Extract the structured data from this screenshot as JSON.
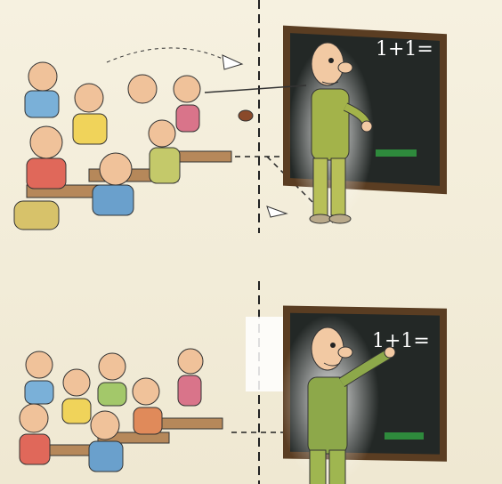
{
  "panels": [
    {
      "id": "top",
      "board_text": "1+1="
    },
    {
      "id": "bottom",
      "board_text": "1+1="
    }
  ]
}
